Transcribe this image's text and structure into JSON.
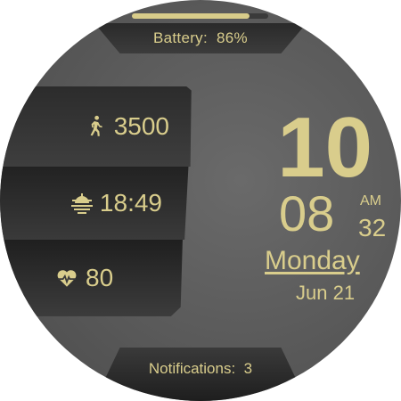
{
  "battery": {
    "label": "Battery:",
    "value": "86%",
    "level": 0.86
  },
  "complications": {
    "steps": {
      "icon": "walking-person-icon",
      "value": "3500"
    },
    "sunrise": {
      "icon": "sunrise-icon",
      "value": "18:49"
    },
    "heart": {
      "icon": "heart-rate-icon",
      "value": "80"
    }
  },
  "clock": {
    "hour": "10",
    "minute": "08",
    "ampm": "AM",
    "seconds": "32",
    "day": "Monday",
    "date": "Jun 21"
  },
  "notifications": {
    "label": "Notifications:",
    "count": "3"
  },
  "colors": {
    "accent": "#d9cd8c",
    "face": "#5c5c5c",
    "panel": "#2c2c2c"
  }
}
